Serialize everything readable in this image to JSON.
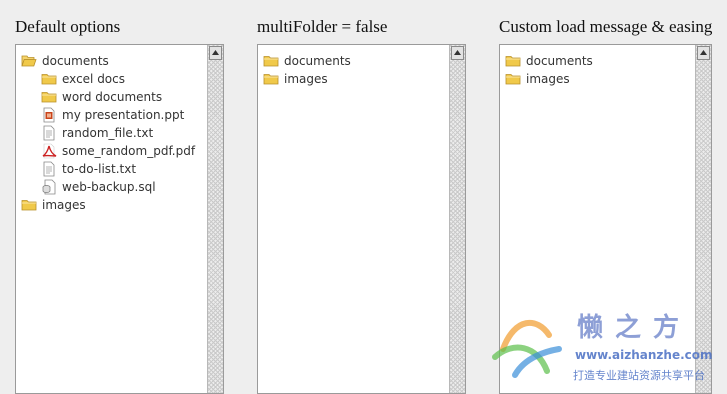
{
  "panels": [
    {
      "title": "Default options",
      "items": [
        {
          "label": "documents",
          "icon": "folder-open-icon"
        },
        {
          "label": "excel docs",
          "icon": "folder-icon"
        },
        {
          "label": "word documents",
          "icon": "folder-icon"
        },
        {
          "label": "my presentation.ppt",
          "icon": "ppt-file-icon"
        },
        {
          "label": "random_file.txt",
          "icon": "text-file-icon"
        },
        {
          "label": "some_random_pdf.pdf",
          "icon": "pdf-file-icon"
        },
        {
          "label": "to-do-list.txt",
          "icon": "text-file-icon"
        },
        {
          "label": "web-backup.sql",
          "icon": "database-file-icon"
        },
        {
          "label": "images",
          "icon": "folder-icon"
        }
      ]
    },
    {
      "title": "multiFolder = false",
      "items": [
        {
          "label": "documents",
          "icon": "folder-icon"
        },
        {
          "label": "images",
          "icon": "folder-icon"
        }
      ]
    },
    {
      "title": "Custom load message & easing",
      "items": [
        {
          "label": "documents",
          "icon": "folder-icon"
        },
        {
          "label": "images",
          "icon": "folder-icon"
        }
      ]
    }
  ],
  "watermark": {
    "brand": "懒之方",
    "url": "www.aizhanzhe.com",
    "slogan": "打造专业建站资源共享平台"
  },
  "colors": {
    "folder": "#f0c94a",
    "pdf": "#cc2222",
    "ppt": "#c8441b",
    "watermark_text": "#4a6fc4"
  }
}
